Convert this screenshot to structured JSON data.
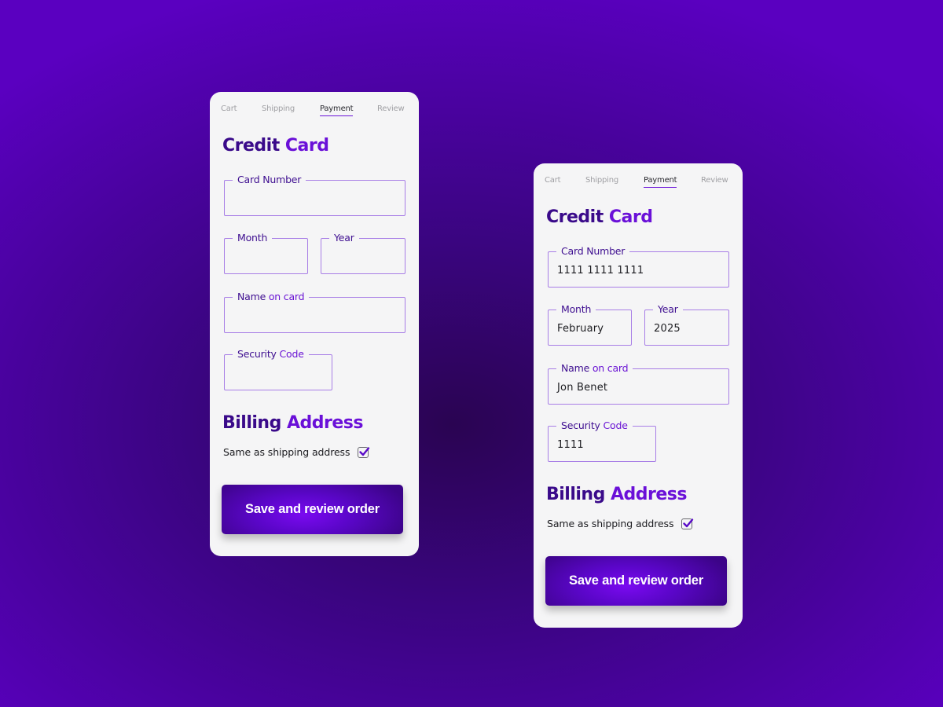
{
  "colors": {
    "background": "#4a02a0",
    "card": "#f5f5f6",
    "heading": "#3a0a8a",
    "accent": "#6a10d8",
    "field_border": "#a87ee6",
    "button": "#5a06c8"
  },
  "cards": [
    {
      "state": "empty",
      "tabs": [
        {
          "label": "Cart",
          "active": false
        },
        {
          "label": "Shipping",
          "active": false
        },
        {
          "label": "Payment",
          "active": true
        },
        {
          "label": "Review",
          "active": false
        }
      ],
      "credit_card_title": {
        "part1": "Credit ",
        "part2": "Card"
      },
      "fields": {
        "card_number": {
          "label1": "Card Number",
          "label2": "",
          "value": ""
        },
        "month": {
          "label1": "Month",
          "label2": "",
          "value": ""
        },
        "year": {
          "label1": "Year",
          "label2": "",
          "value": ""
        },
        "name": {
          "label1": "Name ",
          "label2": "on card",
          "value": ""
        },
        "security_code": {
          "label1": "Security ",
          "label2": "Code",
          "value": ""
        }
      },
      "billing_title": {
        "part1": "Billing ",
        "part2": "Address"
      },
      "same_as_shipping": {
        "label": "Same as shipping address",
        "checked": true
      },
      "save_button": "Save and review order"
    },
    {
      "state": "filled",
      "tabs": [
        {
          "label": "Cart",
          "active": false
        },
        {
          "label": "Shipping",
          "active": false
        },
        {
          "label": "Payment",
          "active": true
        },
        {
          "label": "Review",
          "active": false
        }
      ],
      "credit_card_title": {
        "part1": "Credit ",
        "part2": "Card"
      },
      "fields": {
        "card_number": {
          "label1": "Card Number",
          "label2": "",
          "value": "1111 1111 1111"
        },
        "month": {
          "label1": "Month",
          "label2": "",
          "value": "February"
        },
        "year": {
          "label1": "Year",
          "label2": "",
          "value": "2025"
        },
        "name": {
          "label1": "Name ",
          "label2": "on card",
          "value": "Jon Benet"
        },
        "security_code": {
          "label1": "Security ",
          "label2": "Code",
          "value": "1111"
        }
      },
      "billing_title": {
        "part1": "Billing ",
        "part2": "Address"
      },
      "same_as_shipping": {
        "label": "Same as shipping address",
        "checked": true
      },
      "save_button": "Save and review order"
    }
  ]
}
